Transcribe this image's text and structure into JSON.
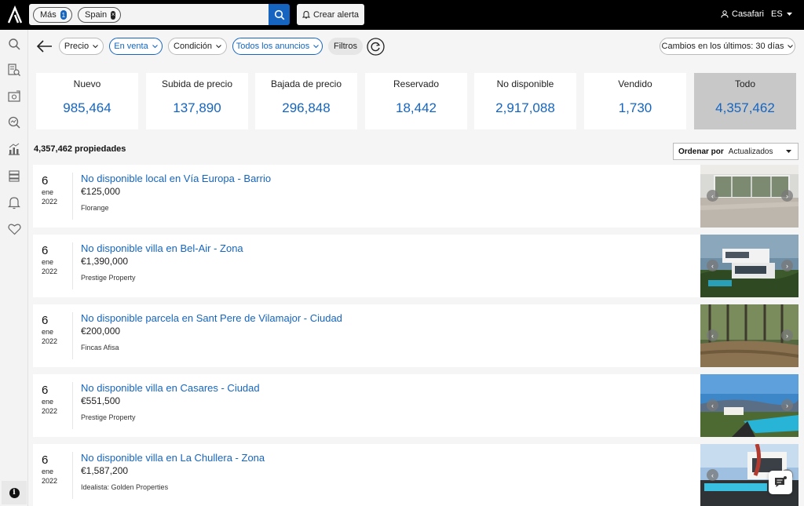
{
  "search": {
    "chips": [
      {
        "label": "Más",
        "count": "1"
      },
      {
        "label": "Spain",
        "remove": "×"
      }
    ]
  },
  "topbar": {
    "alert_label": "Crear alerta",
    "user_name": "Casafari",
    "language": "ES"
  },
  "filters": {
    "price": "Precio",
    "status": "En venta",
    "condition": "Condición",
    "listings": "Todos los anuncios",
    "filters": "Filtros",
    "changes": "Cambios en los últimos: 30 días"
  },
  "stats": [
    {
      "label": "Nuevo",
      "value": "985,464"
    },
    {
      "label": "Subida de precio",
      "value": "137,890"
    },
    {
      "label": "Bajada de precio",
      "value": "296,848"
    },
    {
      "label": "Reservado",
      "value": "18,442"
    },
    {
      "label": "No disponible",
      "value": "2,917,088"
    },
    {
      "label": "Vendido",
      "value": "1,730"
    },
    {
      "label": "Todo",
      "value": "4,357,462"
    }
  ],
  "results": {
    "count": "4,357,462 propiedades",
    "sort_label": "Ordenar por",
    "sort_value": "Actualizados"
  },
  "listings": [
    {
      "day": "6",
      "month": "ene",
      "year": "2022",
      "title": "No disponible local en Vía Europa - Barrio",
      "price": "€125,000",
      "agency": "Florange"
    },
    {
      "day": "6",
      "month": "ene",
      "year": "2022",
      "title": "No disponible villa en Bel-Air - Zona",
      "price": "€1,390,000",
      "agency": "Prestige Property"
    },
    {
      "day": "6",
      "month": "ene",
      "year": "2022",
      "title": "No disponible parcela en Sant Pere de Vilamajor - Ciudad",
      "price": "€200,000",
      "agency": "Fincas Afisa"
    },
    {
      "day": "6",
      "month": "ene",
      "year": "2022",
      "title": "No disponible villa en Casares - Ciudad",
      "price": "€551,500",
      "agency": "Prestige Property"
    },
    {
      "day": "6",
      "month": "ene",
      "year": "2022",
      "title": "No disponible villa en La Chullera - Zona",
      "price": "€1,587,200",
      "agency": "Idealista: Golden Properties"
    }
  ],
  "colors": {
    "accent": "#1565c0",
    "topbar": "#000000",
    "selected_stat": "#c8c8c8"
  },
  "icons": {
    "logo": "casafari-logo-icon",
    "search": "search-icon",
    "bell": "bell-icon",
    "user": "user-icon",
    "chevron": "chevron-down-icon",
    "back": "arrow-left-icon",
    "reset": "refresh-icon",
    "chat": "chat-icon"
  }
}
